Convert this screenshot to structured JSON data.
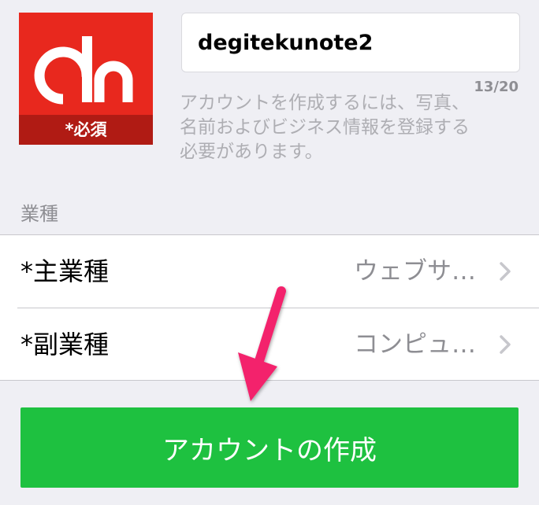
{
  "profile": {
    "photo_required_label": "*必須",
    "logo_icon": "dn-logo-icon",
    "photo_bg_color": "#e8281e",
    "photo_band_color": "#b01b14"
  },
  "account_name": {
    "value": "degitekunote2",
    "char_count": "13/20",
    "help_text": "アカウントを作成するには、写真、名前およびビジネス情報を登録する必要があります。"
  },
  "business_section": {
    "header": "業種",
    "rows": [
      {
        "label": "*主業種",
        "value": "ウェブサ…",
        "icon": "chevron-right-icon"
      },
      {
        "label": "*副業種",
        "value": "コンピュ…",
        "icon": "chevron-right-icon"
      }
    ]
  },
  "create_button": {
    "label": "アカウントの作成",
    "color": "#1ec140"
  },
  "annotation": {
    "icon": "pink-arrow-icon",
    "color": "#f3246c"
  }
}
